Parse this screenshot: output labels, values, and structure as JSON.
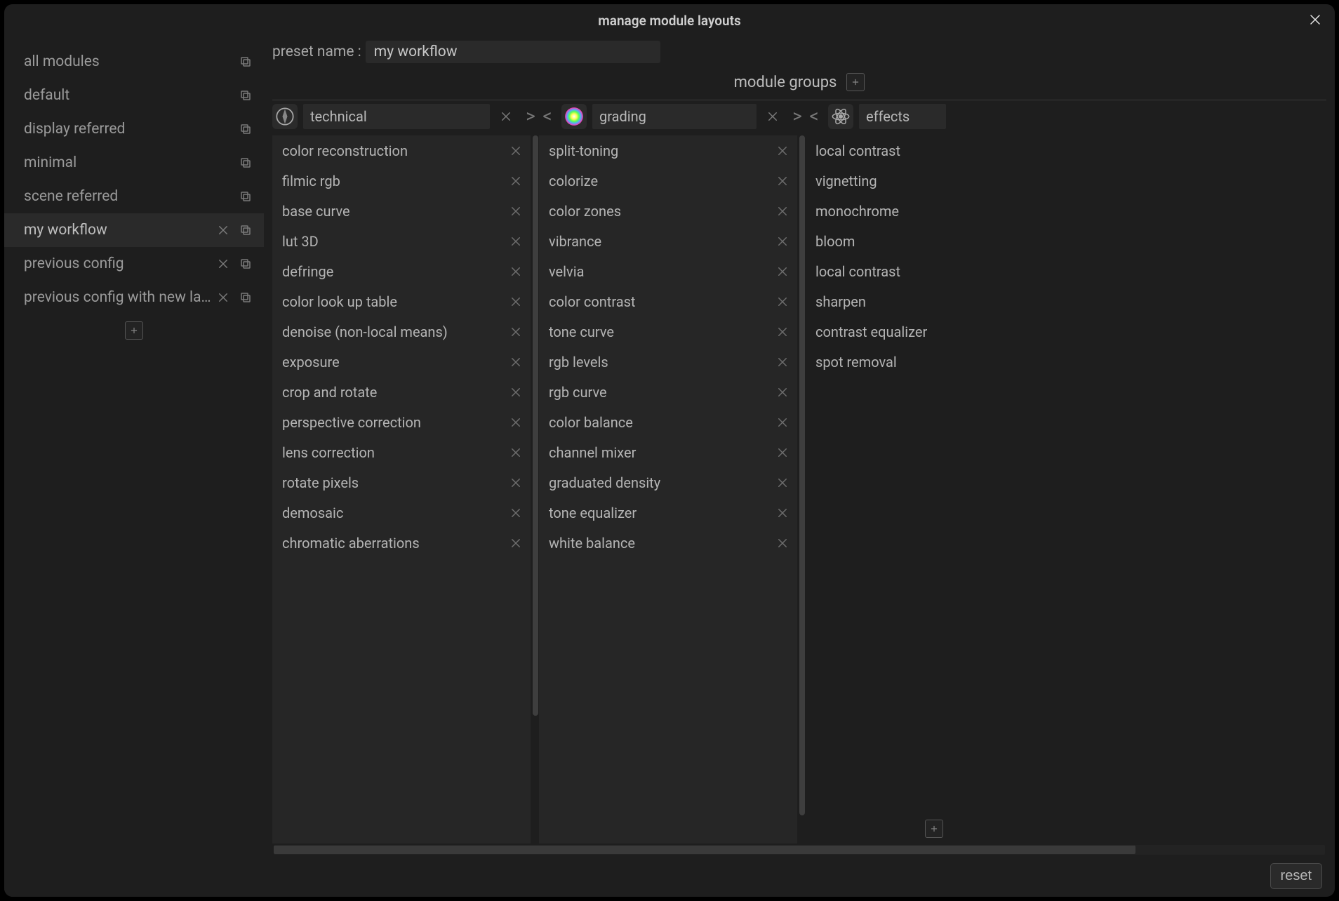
{
  "window": {
    "title": "manage module layouts"
  },
  "sidebar": {
    "presets": [
      {
        "label": "all modules",
        "deletable": false
      },
      {
        "label": "default",
        "deletable": false
      },
      {
        "label": "display referred",
        "deletable": false
      },
      {
        "label": "minimal",
        "deletable": false
      },
      {
        "label": "scene referred",
        "deletable": false
      },
      {
        "label": "my workflow",
        "deletable": true,
        "selected": true
      },
      {
        "label": "previous config",
        "deletable": true
      },
      {
        "label": "previous config with new lay...",
        "deletable": true
      }
    ]
  },
  "main": {
    "preset_name_label": "preset name :",
    "preset_name_value": "my workflow",
    "groups_heading": "module groups",
    "groups": [
      {
        "name": "technical",
        "icon": "compass",
        "show_left_arrow": false,
        "show_right_arrow": true,
        "scroll_thumb_pct": 82,
        "modules": [
          "color reconstruction",
          "filmic rgb",
          "base curve",
          "lut 3D",
          "defringe",
          "color look up table",
          "denoise (non-local means)",
          "exposure",
          "crop and rotate",
          "perspective correction",
          "lens correction",
          "rotate pixels",
          "demosaic",
          "chromatic aberrations"
        ]
      },
      {
        "name": "grading",
        "icon": "rainbow",
        "show_left_arrow": true,
        "show_right_arrow": true,
        "scroll_thumb_pct": 96,
        "modules": [
          "split-toning",
          "colorize",
          "color zones",
          "vibrance",
          "velvia",
          "color contrast",
          "tone curve",
          "rgb levels",
          "rgb curve",
          "color balance",
          "channel mixer",
          "graduated density",
          "tone equalizer",
          "white balance"
        ]
      },
      {
        "name": "effects",
        "icon": "atom",
        "show_left_arrow": true,
        "show_right_arrow": false,
        "truncated": true,
        "scroll_thumb_pct": 0,
        "modules": [
          "local contrast",
          "vignetting",
          "monochrome",
          "bloom",
          "local contrast",
          "sharpen",
          "contrast equalizer",
          "spot removal"
        ]
      }
    ],
    "hscroll_thumb_pct": 82
  },
  "footer": {
    "reset_label": "reset"
  }
}
